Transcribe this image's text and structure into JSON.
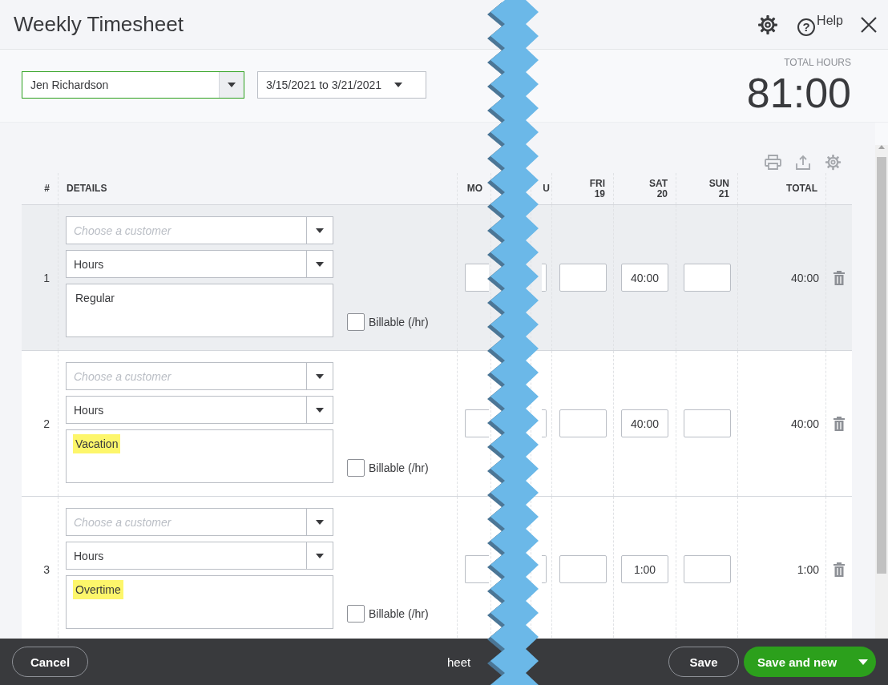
{
  "window": {
    "title": "Weekly Timesheet"
  },
  "header_actions": {
    "help_glyph": "?",
    "help_label": "Help"
  },
  "employee": {
    "value": "Jen Richardson",
    "focused": true
  },
  "date_range": {
    "value": "3/15/2021 to 3/21/2021"
  },
  "total_hours": {
    "label": "TOTAL HOURS",
    "value": "81:00"
  },
  "table": {
    "columns": [
      {
        "label": "#"
      },
      {
        "label": "DETAILS"
      },
      {
        "label": "MO"
      },
      {
        "label": "U"
      },
      {
        "label": "FRI",
        "day": "19"
      },
      {
        "label": "SAT",
        "day": "20"
      },
      {
        "label": "SUN",
        "day": "21"
      },
      {
        "label": "TOTAL"
      }
    ],
    "rows": [
      {
        "number": "1",
        "selected": true,
        "customer": {
          "placeholder": "Choose a customer"
        },
        "service": "Hours",
        "note": "Regular",
        "note_highlighted": false,
        "billable": {
          "label": "Billable (/hr)",
          "checked": false
        },
        "entries": [
          {
            "kind": "cut"
          },
          {
            "kind": "cut"
          },
          {
            "kind": "empty"
          },
          {
            "kind": "filled",
            "value": "40:00"
          },
          {
            "kind": "empty"
          }
        ],
        "total": "40:00"
      },
      {
        "number": "2",
        "selected": false,
        "customer": {
          "placeholder": "Choose a customer"
        },
        "service": "Hours",
        "note": "Vacation",
        "note_highlighted": true,
        "billable": {
          "label": "Billable (/hr)",
          "checked": false
        },
        "entries": [
          {
            "kind": "cut"
          },
          {
            "kind": "cut"
          },
          {
            "kind": "empty"
          },
          {
            "kind": "filled",
            "value": "40:00"
          },
          {
            "kind": "empty"
          }
        ],
        "total": "40:00"
      },
      {
        "number": "3",
        "selected": false,
        "customer": {
          "placeholder": "Choose a customer"
        },
        "service": "Hours",
        "note": "Overtime",
        "note_highlighted": true,
        "billable": {
          "label": "Billable (/hr)",
          "checked": false
        },
        "entries": [
          {
            "kind": "cut"
          },
          {
            "kind": "cut"
          },
          {
            "kind": "empty"
          },
          {
            "kind": "filled",
            "value": "1:00"
          },
          {
            "kind": "empty"
          }
        ],
        "total": "1:00"
      }
    ]
  },
  "footer": {
    "cancel": "Cancel",
    "caption": "heet",
    "save": "Save",
    "save_and_new": "Save and new"
  }
}
